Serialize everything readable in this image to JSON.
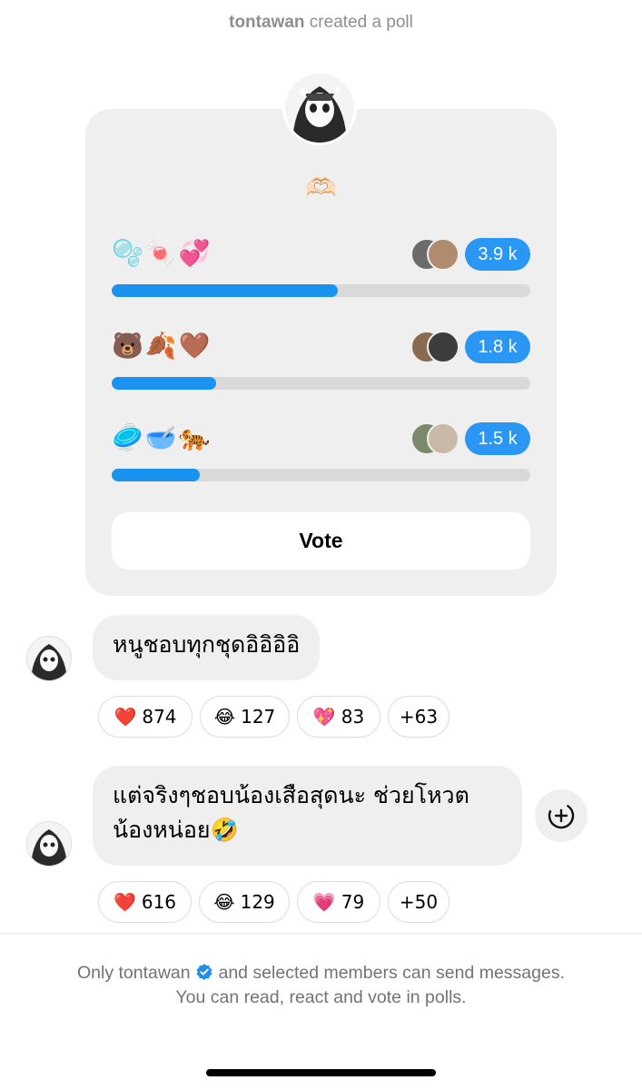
{
  "system_message": {
    "user": "tontawan",
    "text": "created a poll"
  },
  "poll": {
    "question_emoji": "🫶🏻",
    "options": [
      {
        "label": "🫧🍬💞",
        "count": "3.9 k",
        "fraction": 0.54
      },
      {
        "label": "🐻🍂🤎",
        "count": "1.8 k",
        "fraction": 0.25
      },
      {
        "label": "🥏🥣🐅",
        "count": "1.5 k",
        "fraction": 0.21
      }
    ],
    "vote_label": "Vote"
  },
  "messages": [
    {
      "text": "หนูชอบทุกชุดอิอิอิอิ",
      "reactions": [
        {
          "emoji": "❤️",
          "count": "874"
        },
        {
          "emoji": "😂",
          "count": "127"
        },
        {
          "emoji": "💖",
          "count": "83"
        },
        {
          "emoji": "",
          "count": "+63"
        }
      ]
    },
    {
      "text_line1": "แต่จริงๆชอบน้องเสือสุดนะ ช่วยโหวต",
      "text_line2": "น้องหน่อย🤣",
      "reactions": [
        {
          "emoji": "❤️",
          "count": "616"
        },
        {
          "emoji": "😂",
          "count": "129"
        },
        {
          "emoji": "💗",
          "count": "79"
        },
        {
          "emoji": "",
          "count": "+50"
        }
      ]
    }
  ],
  "footer": {
    "line1_prefix": "Only tontawan",
    "line1_suffix": "and selected members can send messages.",
    "line2": "You can read, react and vote in polls."
  },
  "colors": {
    "accent": "#1992f0",
    "bubble": "#efefef",
    "muted": "#737373"
  },
  "icons": [
    "add-reaction-icon",
    "verified-badge-icon"
  ]
}
